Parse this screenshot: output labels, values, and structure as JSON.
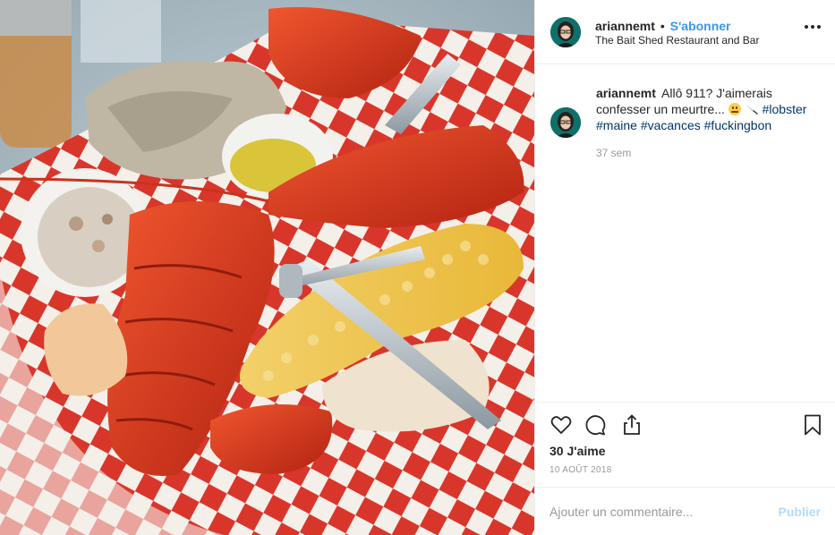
{
  "header": {
    "username": "ariannemt",
    "separator": "•",
    "follow_label": "S'abonner",
    "location": "The Bait Shed Restaurant and Bar",
    "more_icon": "more-horizontal-icon"
  },
  "caption": {
    "username": "ariannemt",
    "text_1": "Allô 911? J'aimerais confesser un meurtre...",
    "emoji_1": "grimacing-face-emoji",
    "emoji_2": "kitchen-knife-emoji",
    "hashtags": [
      "#lobster",
      "#maine",
      "#vacances",
      "#fuckingbon"
    ],
    "time_ago": "37 sem"
  },
  "actions": {
    "icons": [
      "heart-icon",
      "comment-icon",
      "share-icon",
      "bookmark-icon"
    ],
    "likes": "30 J'aime",
    "date": "10 AOÛT 2018"
  },
  "comment": {
    "placeholder": "Ajouter un commentaire...",
    "publish_label": "Publier"
  },
  "colors": {
    "link_blue": "#3897f0",
    "hashtag_blue": "#003569",
    "publish_disabled": "#b3dbff",
    "muted": "#999999",
    "border": "#efefef"
  }
}
